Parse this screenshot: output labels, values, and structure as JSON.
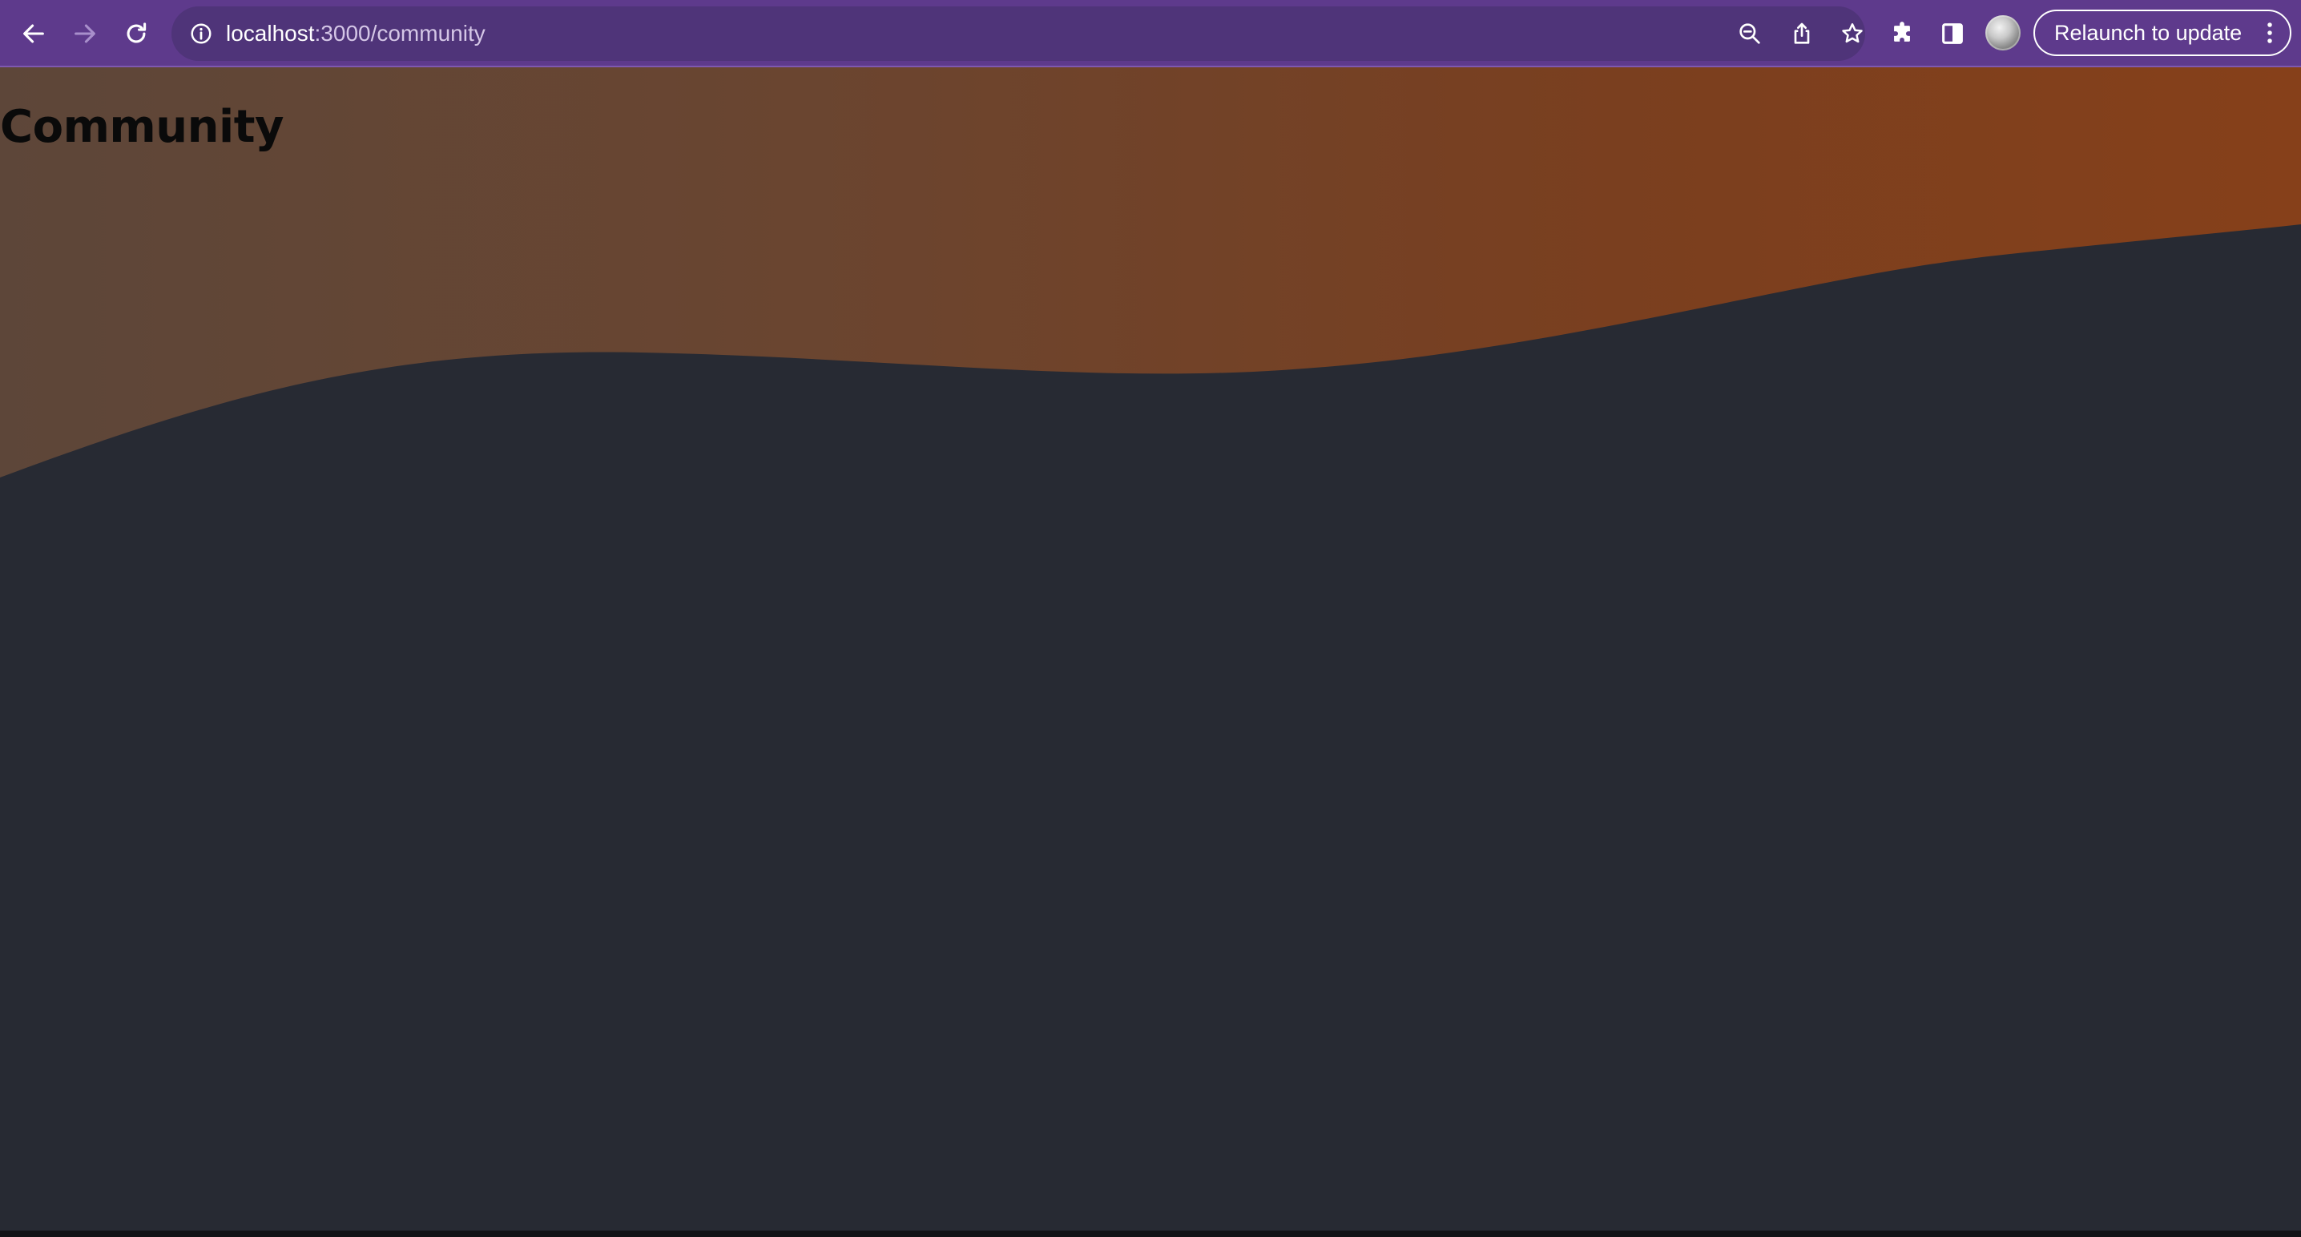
{
  "browser": {
    "url_host": "localhost",
    "url_path": ":3000/community",
    "relaunch_label": "Relaunch to update",
    "icons": {
      "back": "arrow-left-icon",
      "forward": "arrow-right-icon",
      "reload": "reload-icon",
      "site_info": "info-icon",
      "zoom": "zoom-out-icon",
      "share": "share-icon",
      "bookmark": "star-icon",
      "extensions": "puzzle-icon",
      "side_panel": "side-panel-icon",
      "profile": "avatar",
      "menu": "more-vertical-icon"
    },
    "colors": {
      "toolbar": "#5e3a8c",
      "omnibox": "#4f3479"
    }
  },
  "page": {
    "title": "Community",
    "colors": {
      "gradient_start": "#5d4639",
      "gradient_end": "#86401a",
      "wave_fill": "#272a33"
    }
  }
}
